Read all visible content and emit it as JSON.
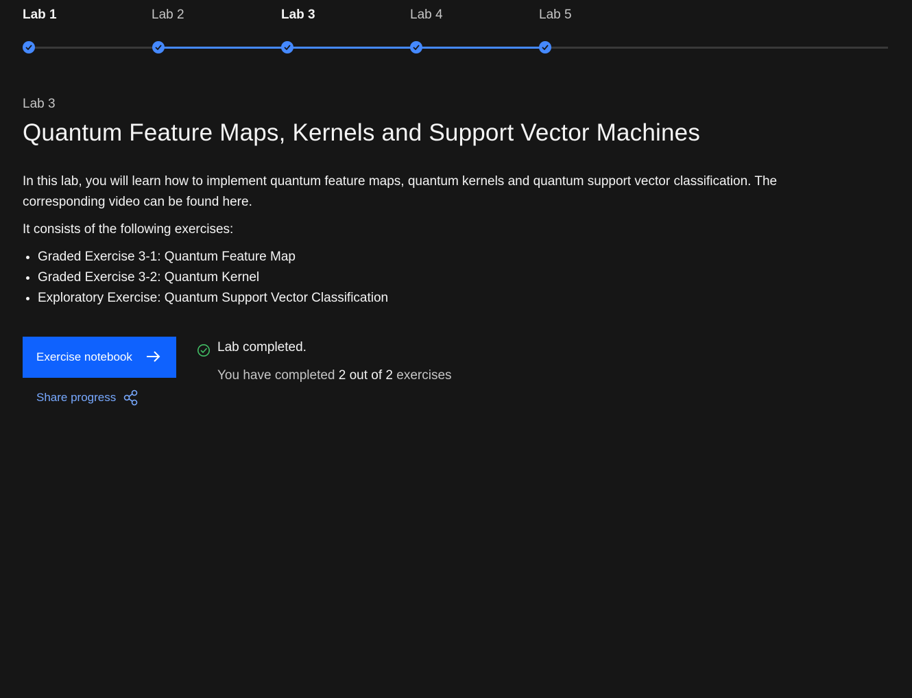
{
  "stepper": {
    "steps": [
      {
        "label": "Lab 1",
        "completed": true
      },
      {
        "label": "Lab 2",
        "completed": true
      },
      {
        "label": "Lab 3",
        "completed": true
      },
      {
        "label": "Lab 4",
        "completed": true
      },
      {
        "label": "Lab 5",
        "completed": true
      }
    ],
    "current": "Lab 3",
    "colors": {
      "active": "#4589ff",
      "inactive": "#393939"
    }
  },
  "lab": {
    "eyebrow": "Lab 3",
    "title": "Quantum Feature Maps, Kernels and Support Vector Machines",
    "intro_text": "In this lab, you will learn how to implement quantum feature maps, quantum kernels and quantum support vector classification. The corresponding video can be found ",
    "intro_link": "here",
    "intro_end": ".",
    "consists": "It consists of the following exercises:",
    "exercises": [
      "Graded Exercise 3-1: Quantum Feature Map",
      "Graded Exercise 3-2: Quantum Kernel",
      "Exploratory Exercise: Quantum Support Vector Classification"
    ]
  },
  "actions": {
    "notebook_label": "Exercise notebook",
    "share_label": "Share progress"
  },
  "status": {
    "title": "Lab completed.",
    "sub_prefix": "You have completed",
    "sub_count": "2 out of 2",
    "sub_suffix": "exercises",
    "color": "#42be65"
  },
  "colors": {
    "background": "#161616",
    "primary_button": "#0f62fe",
    "link": "#78a9ff"
  }
}
